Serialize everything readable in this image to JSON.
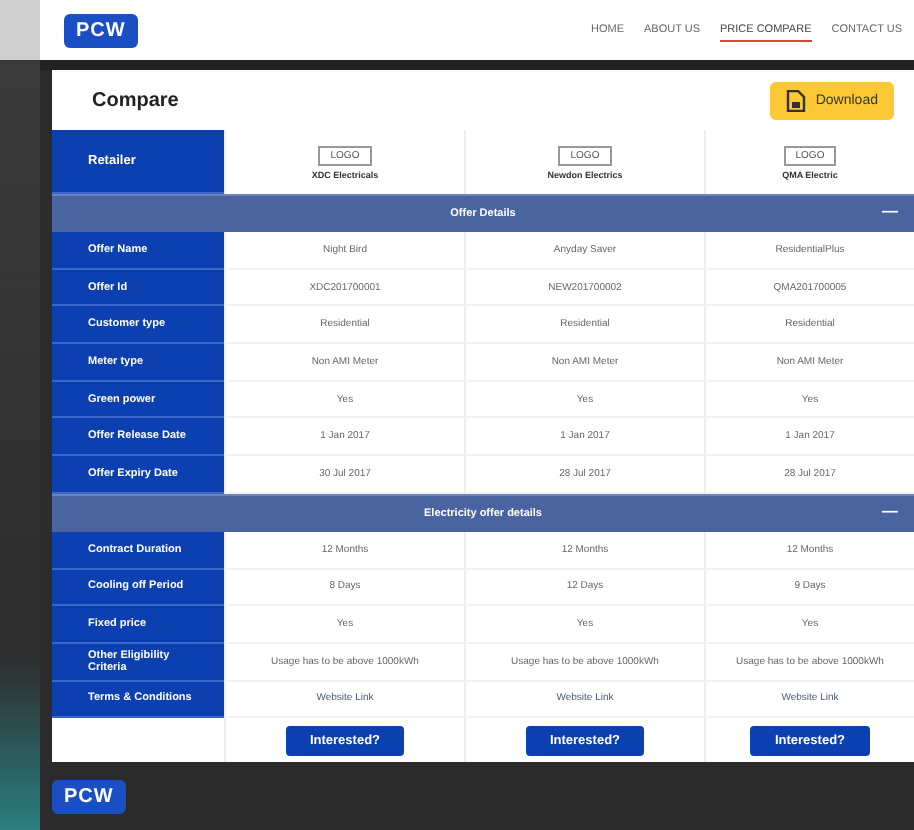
{
  "header": {
    "logo": "PCW",
    "nav": [
      {
        "label": "HOME",
        "selected": false
      },
      {
        "label": "ABOUT US",
        "selected": false
      },
      {
        "label": "PRICE COMPARE",
        "selected": true
      },
      {
        "label": "CONTACT US",
        "selected": false
      }
    ]
  },
  "title": "Compare",
  "download_button": "Download",
  "retailer_label": "Retailer",
  "retailers": [
    {
      "logo": "LOGO",
      "name": "XDC Electricals"
    },
    {
      "logo": "LOGO",
      "name": "Newdon Electrics"
    },
    {
      "logo": "LOGO",
      "name": "QMA Electric"
    }
  ],
  "sections": [
    {
      "title": "Offer Details",
      "toggle": "—",
      "expanded": true,
      "rows": [
        {
          "label": "Offer Name",
          "values": [
            "Night Bird",
            "Anyday Saver",
            "ResidentialPlus"
          ]
        },
        {
          "label": "Offer Id",
          "values": [
            "XDC201700001",
            "NEW201700002",
            "QMA201700005"
          ]
        },
        {
          "label": "Customer type",
          "values": [
            "Residential",
            "Residential",
            "Residential"
          ]
        },
        {
          "label": "Meter type",
          "values": [
            "Non AMI Meter",
            "Non AMI Meter",
            "Non AMI Meter"
          ]
        },
        {
          "label": "Green power",
          "values": [
            "Yes",
            "Yes",
            "Yes"
          ]
        },
        {
          "label": "Offer Release Date",
          "values": [
            "1 Jan 2017",
            "1 Jan 2017",
            "1 Jan 2017"
          ]
        },
        {
          "label": "Offer Expiry Date",
          "values": [
            "30 Jul 2017",
            "28 Jul 2017",
            "28 Jul 2017"
          ]
        }
      ]
    },
    {
      "title": "Electricity offer details",
      "toggle": "—",
      "expanded": true,
      "rows": [
        {
          "label": "Contract Duration",
          "values": [
            "12 Months",
            "12 Months",
            "12 Months"
          ]
        },
        {
          "label": "Cooling off Period",
          "values": [
            "8 Days",
            "12 Days",
            "9 Days"
          ]
        },
        {
          "label": "Fixed price",
          "values": [
            "Yes",
            "Yes",
            "Yes"
          ]
        },
        {
          "label": "Other Eligibility Criteria",
          "values": [
            "Usage has to be above 1000kWh",
            "Usage has to be above 1000kWh",
            "Usage has to be above 1000kWh"
          ]
        },
        {
          "label": "Terms & Conditions",
          "values": [
            "Website Link",
            "Website Link",
            "Website Link"
          ],
          "kind": "link"
        }
      ]
    }
  ],
  "action_buttons": [
    "Interested?",
    "Interested?",
    "Interested?"
  ],
  "footer": {
    "logo": "PCW"
  }
}
